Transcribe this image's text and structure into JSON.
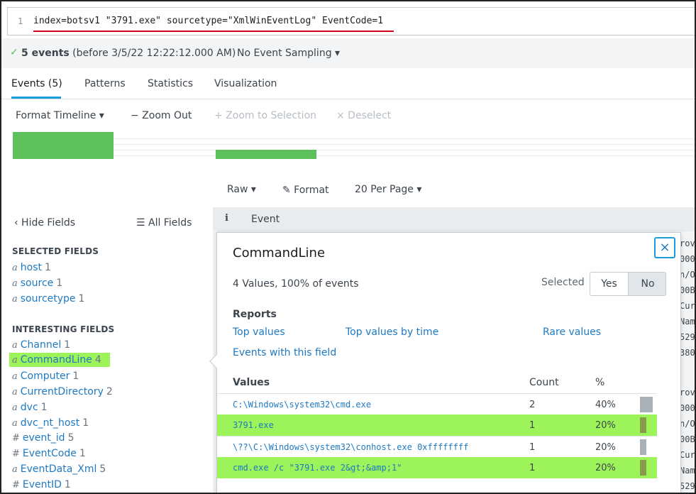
{
  "search": {
    "line_number": "1",
    "query": "index=botsv1 \"3791.exe\" sourcetype=\"XmlWinEventLog\" EventCode=1",
    "underline_color": "#d0021b"
  },
  "status": {
    "check_icon": "✓",
    "count_bold": "5 events",
    "count_rest": " (before 3/5/22 12:22:12.000 AM)",
    "sampling": "No Event Sampling ▾"
  },
  "tabs": [
    {
      "label": "Events (5)",
      "active": true
    },
    {
      "label": "Patterns"
    },
    {
      "label": "Statistics"
    },
    {
      "label": "Visualization"
    }
  ],
  "timeline_toolbar": {
    "format": "Format Timeline ▾",
    "zoom_out": "− Zoom Out",
    "zoom_selection": "+ Zoom to Selection",
    "deselect": "× Deselect"
  },
  "results_toolbar": {
    "raw": "Raw ▾",
    "format": "✎ Format",
    "per_page": "20 Per Page ▾"
  },
  "fields_panel": {
    "hide_fields": "‹ Hide Fields",
    "all_fields": "☰ All Fields",
    "selected_heading": "SELECTED FIELDS",
    "selected": [
      {
        "type": "a",
        "name": "host",
        "count": "1"
      },
      {
        "type": "a",
        "name": "source",
        "count": "1"
      },
      {
        "type": "a",
        "name": "sourcetype",
        "count": "1"
      }
    ],
    "interesting_heading": "INTERESTING FIELDS",
    "interesting": [
      {
        "type": "a",
        "name": "Channel",
        "count": "1"
      },
      {
        "type": "a",
        "name": "CommandLine",
        "count": "4"
      },
      {
        "type": "a",
        "name": "Computer",
        "count": "1"
      },
      {
        "type": "a",
        "name": "CurrentDirectory",
        "count": "2"
      },
      {
        "type": "a",
        "name": "dvc",
        "count": "1"
      },
      {
        "type": "a",
        "name": "dvc_nt_host",
        "count": "1"
      },
      {
        "type": "#",
        "name": "event_id",
        "count": "5"
      },
      {
        "type": "#",
        "name": "EventCode",
        "count": "1"
      },
      {
        "type": "a",
        "name": "EventData_Xml",
        "count": "5"
      },
      {
        "type": "#",
        "name": "EventID",
        "count": "1"
      }
    ]
  },
  "events_header": {
    "info_icon": "i",
    "label": "Event"
  },
  "event_fragments": [
    "rov",
    "000",
    "n/O",
    "00B",
    "Cur",
    "Nam",
    "529",
    "380",
    "rov",
    "000",
    "n/O",
    "00B",
    "Cur",
    "Nam",
    "529"
  ],
  "popup": {
    "title": "CommandLine",
    "close": "×",
    "summary": "4 Values, 100% of events",
    "selected_label": "Selected",
    "yes": "Yes",
    "no": "No",
    "reports_heading": "Reports",
    "links": {
      "top_values": "Top values",
      "top_values_by_time": "Top values by time",
      "rare_values": "Rare values",
      "events_with_field": "Events with this field"
    },
    "columns": {
      "values": "Values",
      "count": "Count",
      "percent": "%"
    },
    "rows": [
      {
        "value": "C:\\Windows\\system32\\cmd.exe",
        "count": "2",
        "percent": "40%",
        "highlight": false,
        "bar_color": "#a8b0b8"
      },
      {
        "value": "3791.exe",
        "count": "1",
        "percent": "20%",
        "highlight": true,
        "bar_color": "#8a9a4a"
      },
      {
        "value": "\\??\\C:\\Windows\\system32\\conhost.exe 0xffffffff",
        "count": "1",
        "percent": "20%",
        "highlight": false,
        "bar_color": "#a8b0b8"
      },
      {
        "value": "cmd.exe /c \"3791.exe 2&gt;&amp;1\"",
        "count": "1",
        "percent": "20%",
        "highlight": true,
        "bar_color": "#8a9a4a"
      }
    ]
  },
  "colors": {
    "accent": "#1a9ed8",
    "link": "#1e79c2",
    "highlight": "#9cf35a",
    "timeline_bar": "#5cc05c"
  }
}
